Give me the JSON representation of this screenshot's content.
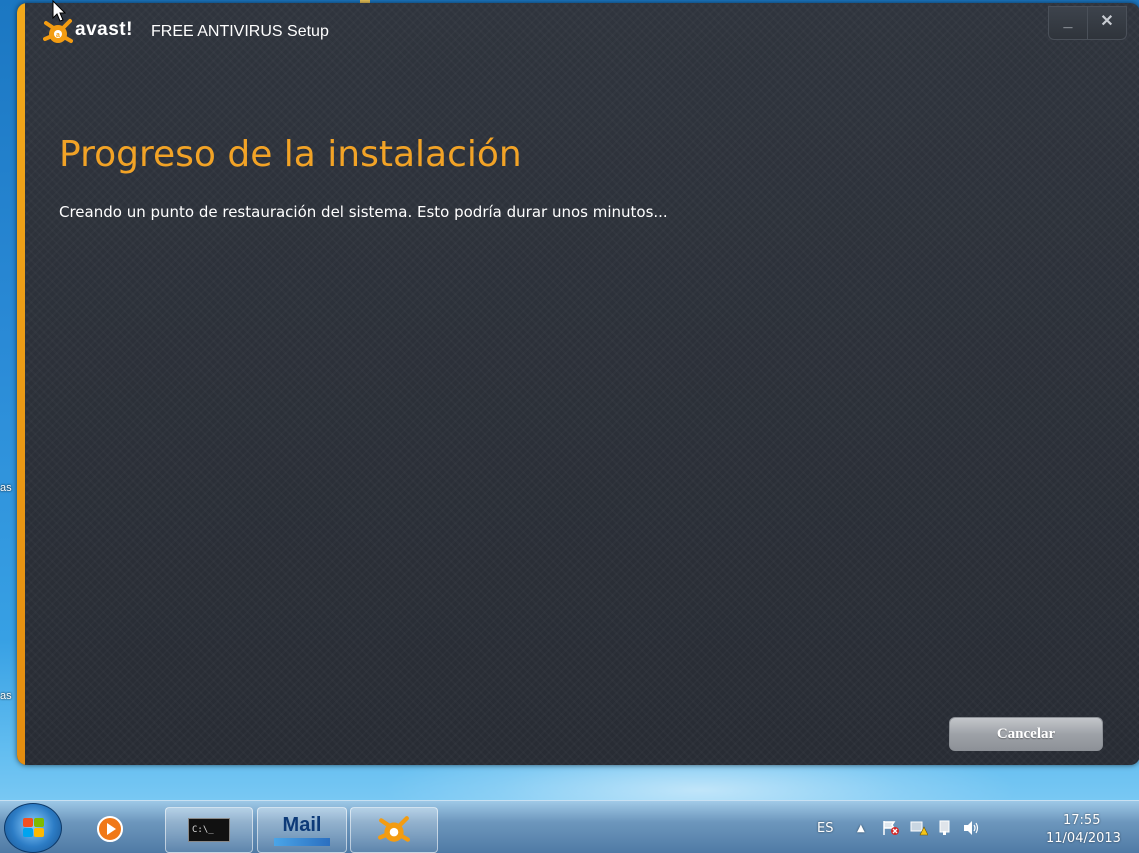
{
  "window": {
    "brand": "avast!",
    "title": "FREE ANTIVIRUS Setup",
    "minimize_label": "_",
    "close_label": "✕"
  },
  "main": {
    "heading": "Progreso de la instalación",
    "status_text": "Creando un punto de restauración del sistema. Esto podría durar unos minutos...",
    "cancel_label": "Cancelar"
  },
  "desktop": {
    "label_upper": "as",
    "label_lower": "as"
  },
  "taskbar": {
    "cmd_text": "C:\\_",
    "mail_text": "Mail",
    "language": "ES",
    "time": "17:55",
    "date": "11/04/2013"
  },
  "colors": {
    "accent": "#f2a326",
    "window_bg": "#2b3039"
  }
}
